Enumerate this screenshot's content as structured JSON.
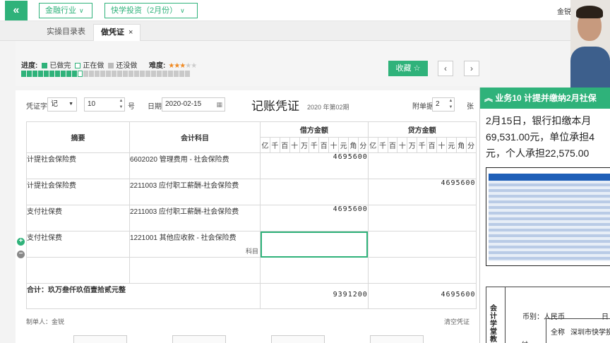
{
  "topbar": {
    "industry_label": "金融行业",
    "company_label": "快学投资（2月份）",
    "user": "金锐"
  },
  "tabs": [
    {
      "label": "实操目录表",
      "active": false
    },
    {
      "label": "做凭证",
      "active": true
    }
  ],
  "progress": {
    "label": "进度:",
    "done": "已做完",
    "doing": "正在做",
    "todo": "还没做",
    "difficulty_label": "难度:",
    "difficulty_stars": 3,
    "difficulty_max": 5,
    "segments_done": 10,
    "current_segment": 11,
    "segments_total": 30
  },
  "actions": {
    "favorite": "收藏 ☆",
    "prev": "‹",
    "next": "›"
  },
  "voucher": {
    "type_label": "凭证字",
    "type_value": "记",
    "number_value": "10",
    "number_suffix": "号",
    "date_label": "日期",
    "date_value": "2020-02-15",
    "title": "记账凭证",
    "period": "2020 年第02期",
    "attachments_label": "附单据",
    "attachments_value": "2",
    "attachments_suffix": "张",
    "headers": {
      "summary": "摘要",
      "account": "会计科目",
      "debit": "借方金额",
      "credit": "贷方金额"
    },
    "units": [
      "亿",
      "千",
      "百",
      "十",
      "万",
      "千",
      "百",
      "十",
      "元",
      "角",
      "分"
    ],
    "rows": [
      {
        "summary": "计提社会保险费",
        "account": "6602020 管理费用 - 社会保险费",
        "debit": "4695600",
        "credit": ""
      },
      {
        "summary": "计提社会保险费",
        "account": "2211003 应付职工薪酬-社会保险费",
        "debit": "",
        "credit": "4695600"
      },
      {
        "summary": "支付社保费",
        "account": "2211003 应付职工薪酬-社会保险费",
        "debit": "4695600",
        "credit": ""
      },
      {
        "summary": "支付社保费",
        "account": "1221001 其他应收款 - 社会保险费",
        "debit": "",
        "credit": ""
      },
      {
        "summary": "",
        "account": "",
        "debit": "",
        "credit": ""
      }
    ],
    "active_cell_tag": "科目",
    "total_label": "合计：玖万叁仟玖佰壹拾贰元整",
    "total_debit": "9391200",
    "total_credit": "4695600",
    "maker_label": "制单人：金锐",
    "clear_label": "清空凭证"
  },
  "task": {
    "title": "业务10 计提并缴纳2月社保",
    "desc_lines": [
      "2月15日，银行扣缴本月",
      "69,531.00元，单位承担4",
      "元，个人承担22,575.00"
    ],
    "slip_vertical": "会计学堂教",
    "slip_currency": "币别：人民币",
    "slip_date_prefix": "日",
    "slip_name_label": "全称",
    "slip_name_value": "深圳市快学投",
    "slip_side_char": "付"
  },
  "colors": {
    "accent": "#2fb27a",
    "debit_line": "#9ec8f0",
    "credit_line": "#f0a0a0"
  }
}
